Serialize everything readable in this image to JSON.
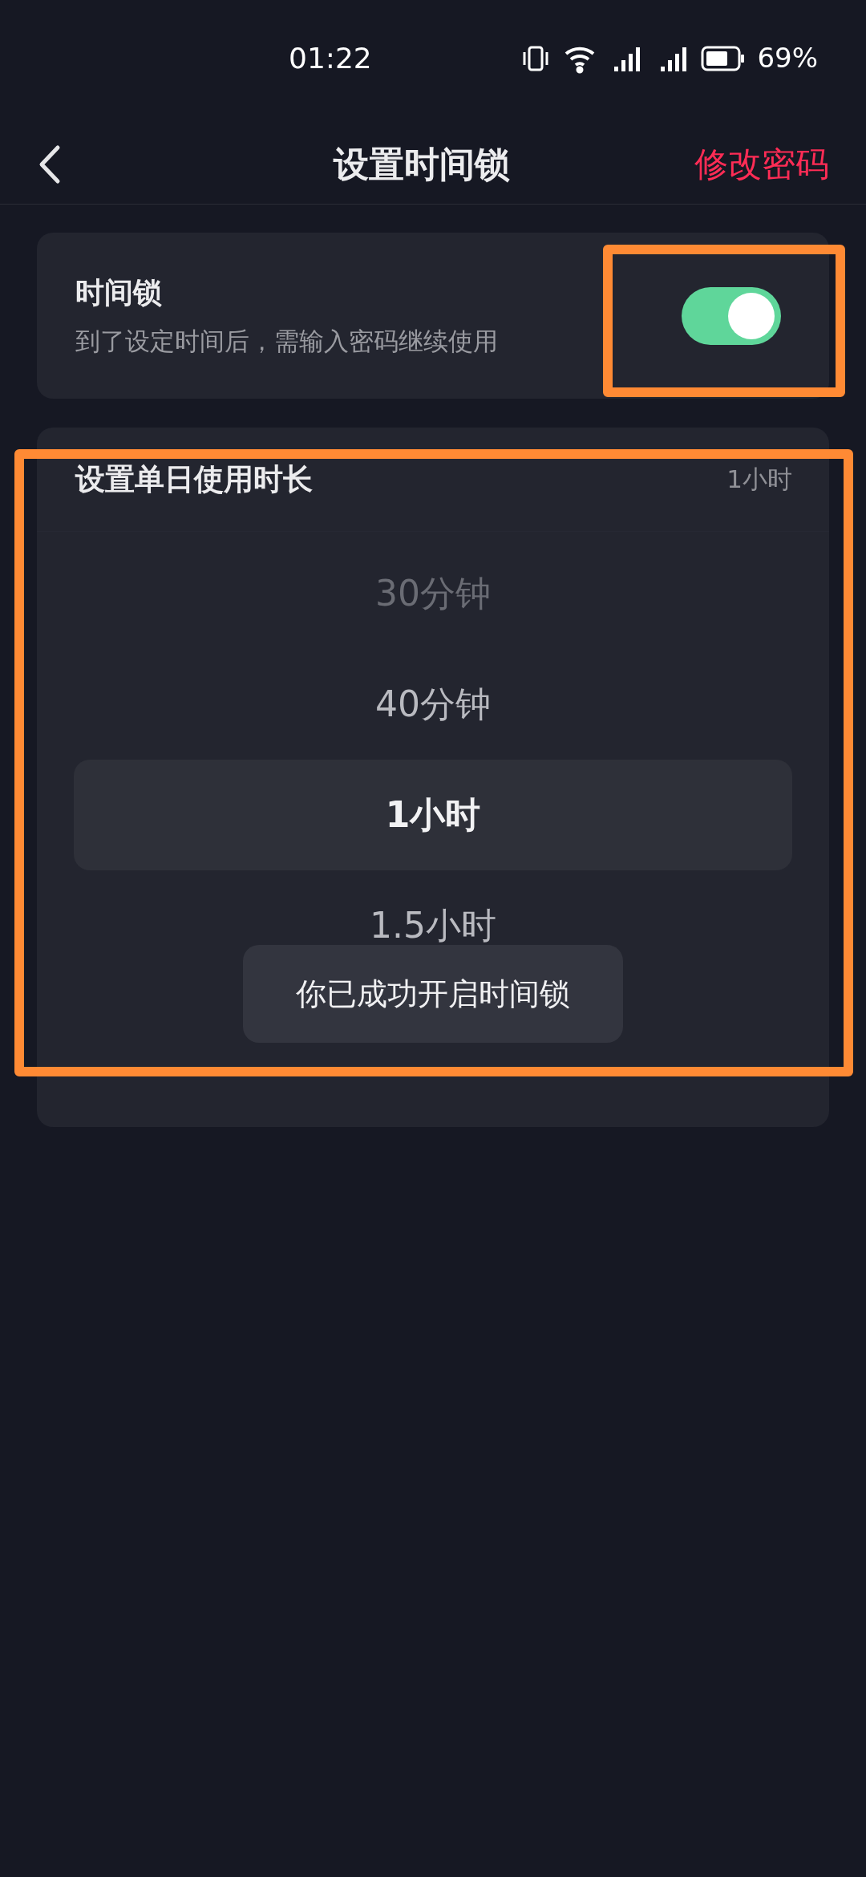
{
  "status_bar": {
    "time": "01:22",
    "battery": "69%"
  },
  "header": {
    "title": "设置时间锁",
    "action": "修改密码"
  },
  "time_lock": {
    "title": "时间锁",
    "description": "到了设定时间后，需输入密码继续使用",
    "on": true,
    "highlighted": true
  },
  "duration": {
    "title": "设置单日使用时长",
    "value": "1小时",
    "highlighted": true,
    "options": [
      {
        "label": "30分钟",
        "selected": false
      },
      {
        "label": "40分钟",
        "selected": false
      },
      {
        "label": "1小时",
        "selected": true
      },
      {
        "label": "1.5小时",
        "selected": false
      }
    ]
  },
  "toast": "你已成功开启时间锁"
}
